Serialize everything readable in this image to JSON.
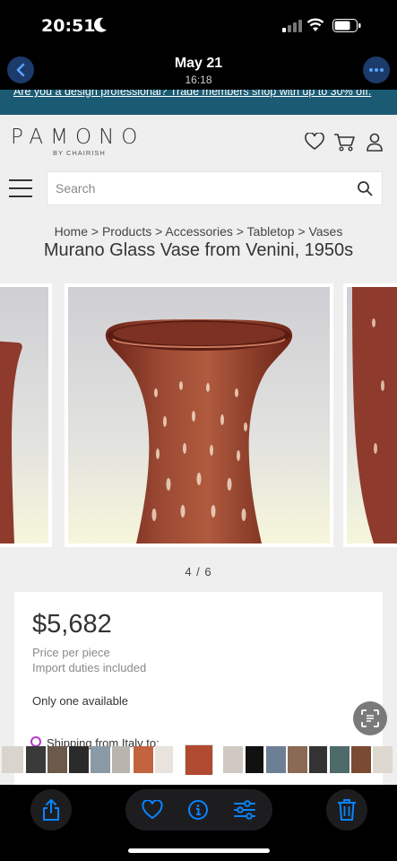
{
  "status_bar": {
    "time": "20:51"
  },
  "header": {
    "date": "May 21",
    "time": "16:18"
  },
  "promo": {
    "text": "Are you a design professional? Trade members shop with up to 30% off."
  },
  "brand": {
    "logo": "PAMONO",
    "sub": "BY CHAIRISH"
  },
  "search": {
    "placeholder": "Search"
  },
  "breadcrumb": "Home > Products > Accessories > Tabletop > Vases",
  "product": {
    "title": "Murano Glass Vase from Venini, 1950s",
    "slide_counter": "4 / 6",
    "price": "$5,682",
    "price_unit": "Price per piece",
    "duties": "Import duties included",
    "availability": "Only one available",
    "shipping": "Shipping from Italy to:"
  },
  "icons": {
    "back": "chevron-left-icon",
    "more": "ellipsis-icon",
    "favorite": "heart-icon",
    "cart": "cart-icon",
    "account": "user-icon",
    "menu": "hamburger-icon",
    "search": "search-icon",
    "visual_lookup": "visual-lookup-icon",
    "share": "share-icon",
    "like": "heart-icon",
    "info": "info-icon",
    "adjust": "sliders-icon",
    "delete": "trash-icon"
  },
  "colors": {
    "accent_blue": "#0a84ff",
    "banner": "#1a5a72",
    "vase": "#8e3a2c",
    "shipping_dot": "#b339c9"
  }
}
